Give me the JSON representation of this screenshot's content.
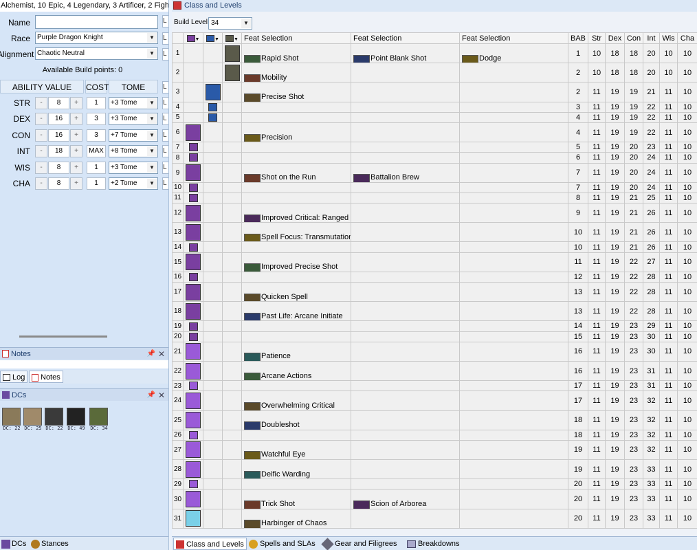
{
  "left": {
    "title": "Alchemist, 10 Epic, 4 Legendary, 3 Artificer, 2 Figh",
    "name_label": "Name",
    "name_value": "",
    "race_label": "Race",
    "race_value": "Purple Dragon Knight",
    "alignment_label": "Alignment",
    "alignment_value": "Chaotic Neutral",
    "build_points": "Available Build points: 0",
    "headers": {
      "ability": "ABILITY VALUE",
      "cost": "COST",
      "tome": "TOME"
    },
    "stub_letter": "L",
    "abilities": [
      {
        "name": "STR",
        "value": "8",
        "cost": "1",
        "tome": "+3 Tome"
      },
      {
        "name": "DEX",
        "value": "16",
        "cost": "3",
        "tome": "+3 Tome"
      },
      {
        "name": "CON",
        "value": "16",
        "cost": "3",
        "tome": "+7 Tome"
      },
      {
        "name": "INT",
        "value": "18",
        "cost": "MAX",
        "tome": "+8 Tome"
      },
      {
        "name": "WIS",
        "value": "8",
        "cost": "1",
        "tome": "+3 Tome"
      },
      {
        "name": "CHA",
        "value": "8",
        "cost": "1",
        "tome": "+2 Tome"
      }
    ],
    "minus": "-",
    "plus": "+",
    "notes_panel_title": "Notes",
    "tabs": {
      "log": "Log",
      "notes": "Notes"
    },
    "dcs_panel_title": "DCs",
    "dcs": [
      "DC: 22",
      "DC: 25",
      "DC: 22",
      "DC: 49",
      "DC: 34"
    ],
    "bottom_tabs": {
      "dcs": "DCs",
      "stances": "Stances"
    }
  },
  "right": {
    "title": "Class and Levels",
    "build_level_label": "Build Level",
    "build_level_value": "34",
    "columns": {
      "feat1": "Feat Selection",
      "feat2": "Feat Selection",
      "feat3": "Feat Selection",
      "bab": "BAB",
      "str": "Str",
      "dex": "Dex",
      "con": "Con",
      "int": "Int",
      "wis": "Wis",
      "cha": "Cha"
    },
    "rows": [
      {
        "lvl": "1",
        "c1": "",
        "c2": "",
        "c3": "f",
        "f1": {
          "n": "Rapid Shot",
          "t": "Purple Dragon Knight Bon..."
        },
        "f2": {
          "n": "Point Blank Shot",
          "t": "Standard"
        },
        "f3": {
          "n": "Dodge",
          "t": "Fighter Bonus Feat"
        },
        "bab": "1",
        "s": [
          "10",
          "18",
          "18",
          "20",
          "10",
          "10"
        ],
        "tall": true
      },
      {
        "lvl": "2",
        "c1": "",
        "c2": "",
        "c3": "f",
        "f1": {
          "n": "Mobility",
          "t": "Fighter Bonus Feat"
        },
        "bab": "2",
        "s": [
          "10",
          "18",
          "18",
          "20",
          "10",
          "10"
        ],
        "tall": true
      },
      {
        "lvl": "3",
        "c1": "",
        "c2": "a",
        "c3": "",
        "f1": {
          "n": "Precise Shot",
          "t": "Standard"
        },
        "bab": "2",
        "s": [
          "11",
          "19",
          "19",
          "21",
          "11",
          "10"
        ],
        "tall": true
      },
      {
        "lvl": "4",
        "c1": "",
        "c2": "a",
        "c3": "",
        "bab": "3",
        "s": [
          "11",
          "19",
          "19",
          "22",
          "11",
          "10"
        ]
      },
      {
        "lvl": "5",
        "c1": "",
        "c2": "a",
        "c3": "",
        "bab": "4",
        "s": [
          "11",
          "19",
          "19",
          "22",
          "11",
          "10"
        ]
      },
      {
        "lvl": "6",
        "c1": "al",
        "c2": "",
        "c3": "",
        "f1": {
          "n": "Precision",
          "t": "Standard"
        },
        "bab": "4",
        "s": [
          "11",
          "19",
          "19",
          "22",
          "11",
          "10"
        ],
        "tall": true
      },
      {
        "lvl": "7",
        "c1": "al",
        "c2": "",
        "c3": "",
        "bab": "5",
        "s": [
          "11",
          "19",
          "20",
          "23",
          "11",
          "10"
        ]
      },
      {
        "lvl": "8",
        "c1": "al",
        "c2": "",
        "c3": "",
        "bab": "6",
        "s": [
          "11",
          "19",
          "20",
          "24",
          "11",
          "10"
        ]
      },
      {
        "lvl": "9",
        "c1": "al",
        "c2": "",
        "c3": "",
        "f1": {
          "n": "Shot on the Run",
          "t": "Standard"
        },
        "f2": {
          "n": "Battalion Brew",
          "t": "Alchemist Bonus Feat"
        },
        "bab": "7",
        "s": [
          "11",
          "19",
          "20",
          "24",
          "11",
          "10"
        ],
        "tall": true
      },
      {
        "lvl": "10",
        "c1": "al",
        "c2": "",
        "c3": "",
        "bab": "7",
        "s": [
          "11",
          "19",
          "20",
          "24",
          "11",
          "10"
        ]
      },
      {
        "lvl": "11",
        "c1": "al",
        "c2": "",
        "c3": "",
        "bab": "8",
        "s": [
          "11",
          "19",
          "21",
          "25",
          "11",
          "10"
        ]
      },
      {
        "lvl": "12",
        "c1": "al",
        "c2": "",
        "c3": "",
        "f1": {
          "n": "Improved Critical: Ranged W",
          "t": "Standard"
        },
        "bab": "9",
        "s": [
          "11",
          "19",
          "21",
          "26",
          "11",
          "10"
        ],
        "tall": true
      },
      {
        "lvl": "13",
        "c1": "al",
        "c2": "",
        "c3": "",
        "f1": {
          "n": "Spell Focus: Transmutation",
          "t": "Alchemist Bonus Feat"
        },
        "bab": "10",
        "s": [
          "11",
          "19",
          "21",
          "26",
          "11",
          "10"
        ],
        "tall": true
      },
      {
        "lvl": "14",
        "c1": "al",
        "c2": "",
        "c3": "",
        "bab": "10",
        "s": [
          "11",
          "19",
          "21",
          "26",
          "11",
          "10"
        ]
      },
      {
        "lvl": "15",
        "c1": "al",
        "c2": "",
        "c3": "",
        "f1": {
          "n": "Improved Precise Shot",
          "t": "Standard"
        },
        "bab": "11",
        "s": [
          "11",
          "19",
          "22",
          "27",
          "11",
          "10"
        ],
        "tall": true
      },
      {
        "lvl": "16",
        "c1": "al",
        "c2": "",
        "c3": "",
        "bab": "12",
        "s": [
          "11",
          "19",
          "22",
          "28",
          "11",
          "10"
        ]
      },
      {
        "lvl": "17",
        "c1": "al",
        "c2": "",
        "c3": "",
        "f1": {
          "n": "Quicken Spell",
          "t": "Alchemist Bonus Feat"
        },
        "bab": "13",
        "s": [
          "11",
          "19",
          "22",
          "28",
          "11",
          "10"
        ],
        "tall": true
      },
      {
        "lvl": "18",
        "c1": "al",
        "c2": "",
        "c3": "",
        "f1": {
          "n": "Past Life: Arcane Initiate",
          "t": "Standard"
        },
        "bab": "13",
        "s": [
          "11",
          "19",
          "22",
          "28",
          "11",
          "10"
        ],
        "tall": true
      },
      {
        "lvl": "19",
        "c1": "al",
        "c2": "",
        "c3": "",
        "bab": "14",
        "s": [
          "11",
          "19",
          "23",
          "29",
          "11",
          "10"
        ]
      },
      {
        "lvl": "20",
        "c1": "al",
        "c2": "",
        "c3": "",
        "bab": "15",
        "s": [
          "11",
          "19",
          "23",
          "30",
          "11",
          "10"
        ]
      },
      {
        "lvl": "21",
        "c1": "ep",
        "c2": "",
        "c3": "",
        "f1": {
          "n": "Patience",
          "t": "Epic Feat"
        },
        "bab": "16",
        "s": [
          "11",
          "19",
          "23",
          "30",
          "11",
          "10"
        ],
        "tall": true
      },
      {
        "lvl": "22",
        "c1": "ep",
        "c2": "",
        "c3": "",
        "f1": {
          "n": "Arcane Actions",
          "t": "Epic Destiny Feat"
        },
        "bab": "16",
        "s": [
          "11",
          "19",
          "23",
          "31",
          "11",
          "10"
        ],
        "tall": true
      },
      {
        "lvl": "23",
        "c1": "ep",
        "c2": "",
        "c3": "",
        "bab": "17",
        "s": [
          "11",
          "19",
          "23",
          "31",
          "11",
          "10"
        ]
      },
      {
        "lvl": "24",
        "c1": "ep",
        "c2": "",
        "c3": "",
        "f1": {
          "n": "Overwhelming Critical",
          "t": "Epic Feat"
        },
        "bab": "17",
        "s": [
          "11",
          "19",
          "23",
          "32",
          "11",
          "10"
        ],
        "tall": true
      },
      {
        "lvl": "25",
        "c1": "ep",
        "c2": "",
        "c3": "",
        "f1": {
          "n": "Doubleshot",
          "t": "Epic Destiny Feat"
        },
        "bab": "18",
        "s": [
          "11",
          "19",
          "23",
          "32",
          "11",
          "10"
        ],
        "tall": true
      },
      {
        "lvl": "26",
        "c1": "ep",
        "c2": "",
        "c3": "",
        "bab": "18",
        "s": [
          "11",
          "19",
          "23",
          "32",
          "11",
          "10"
        ]
      },
      {
        "lvl": "27",
        "c1": "ep",
        "c2": "",
        "c3": "",
        "f1": {
          "n": "Watchful Eye",
          "t": "Epic Feat"
        },
        "bab": "19",
        "s": [
          "11",
          "19",
          "23",
          "32",
          "11",
          "10"
        ],
        "tall": true
      },
      {
        "lvl": "28",
        "c1": "ep",
        "c2": "",
        "c3": "",
        "f1": {
          "n": "Deific Warding",
          "t": "Epic Destiny Feat"
        },
        "bab": "19",
        "s": [
          "11",
          "19",
          "23",
          "33",
          "11",
          "10"
        ],
        "tall": true
      },
      {
        "lvl": "29",
        "c1": "ep",
        "c2": "",
        "c3": "",
        "bab": "20",
        "s": [
          "11",
          "19",
          "23",
          "33",
          "11",
          "10"
        ]
      },
      {
        "lvl": "30",
        "c1": "ep",
        "c2": "",
        "c3": "",
        "f1": {
          "n": "Trick Shot",
          "t": "Epic Feat"
        },
        "f2": {
          "n": "Scion of Arborea",
          "t": "Legendary Feat"
        },
        "bab": "20",
        "s": [
          "11",
          "19",
          "23",
          "33",
          "11",
          "10"
        ],
        "tall": true
      },
      {
        "lvl": "31",
        "c1": "lg",
        "c2": "",
        "c3": "",
        "f1": {
          "n": "Harbinger of Chaos",
          "t": "Epic Destiny Feat"
        },
        "bab": "20",
        "s": [
          "11",
          "19",
          "23",
          "33",
          "11",
          "10"
        ],
        "tall": true
      }
    ],
    "bottom_tabs": {
      "class": "Class and Levels",
      "spells": "Spells and SLAs",
      "gear": "Gear and Filigrees",
      "breakdowns": "Breakdowns"
    }
  },
  "colors": {
    "alchemist": "#7a3fa0",
    "artificer": "#2a5aa8",
    "fighter": "#5a5a4a",
    "epic": "#9a5ad8",
    "legendary": "#7ad0e8"
  }
}
